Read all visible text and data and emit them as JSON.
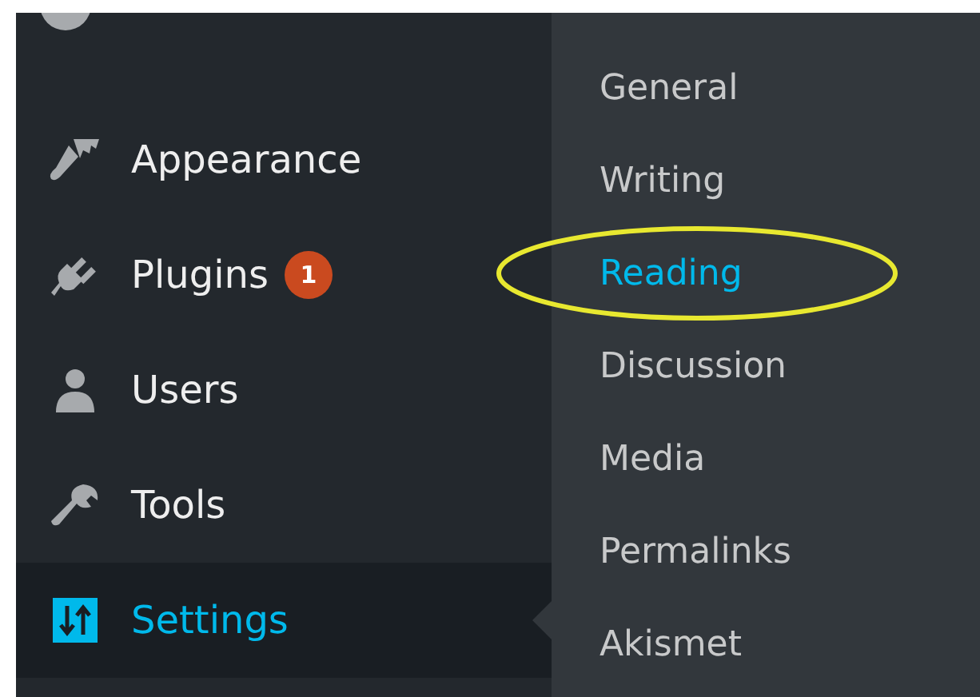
{
  "menu": {
    "items": [
      {
        "label": "Appearance",
        "kind": "brush",
        "selected": false
      },
      {
        "label": "Plugins",
        "kind": "plug",
        "selected": false,
        "badge": "1"
      },
      {
        "label": "Users",
        "kind": "user",
        "selected": false
      },
      {
        "label": "Tools",
        "kind": "wrench",
        "selected": false
      },
      {
        "label": "Settings",
        "kind": "sliders",
        "selected": true
      }
    ]
  },
  "submenu": {
    "items": [
      {
        "label": "General",
        "selected": false
      },
      {
        "label": "Writing",
        "selected": false
      },
      {
        "label": "Reading",
        "selected": true
      },
      {
        "label": "Discussion",
        "selected": false
      },
      {
        "label": "Media",
        "selected": false
      },
      {
        "label": "Permalinks",
        "selected": false
      },
      {
        "label": "Akismet",
        "selected": false
      }
    ]
  }
}
